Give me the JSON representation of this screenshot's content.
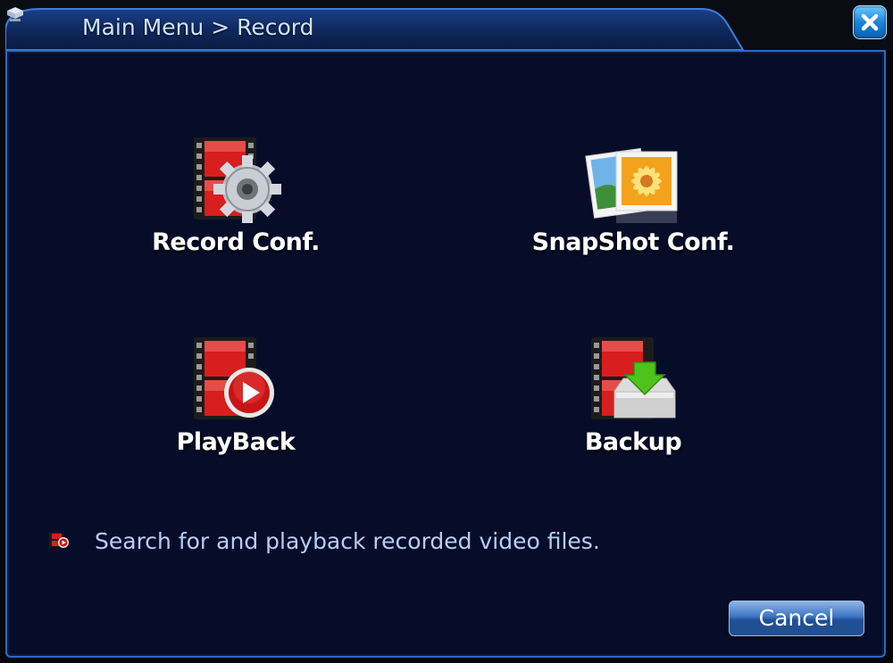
{
  "window": {
    "title": "Main Menu > Record",
    "title_icon": "dvr-device-icon",
    "close_icon": "close-icon"
  },
  "menu": {
    "items": [
      {
        "id": "record-conf",
        "label": "Record Conf.",
        "icon": "film-gear-icon"
      },
      {
        "id": "snapshot-conf",
        "label": "SnapShot Conf.",
        "icon": "photos-icon"
      },
      {
        "id": "playback",
        "label": "PlayBack",
        "icon": "film-play-icon"
      },
      {
        "id": "backup",
        "label": "Backup",
        "icon": "film-backup-icon"
      }
    ]
  },
  "hint": {
    "icon": "film-play-small-icon",
    "text": "Search for and playback recorded video files."
  },
  "footer": {
    "cancel_label": "Cancel"
  },
  "colors": {
    "background": "#070d29",
    "border": "#2a6ac4",
    "title_text": "#cfe3ff",
    "hint_text": "#b9cdf4",
    "film_red": "#d81e1e"
  }
}
